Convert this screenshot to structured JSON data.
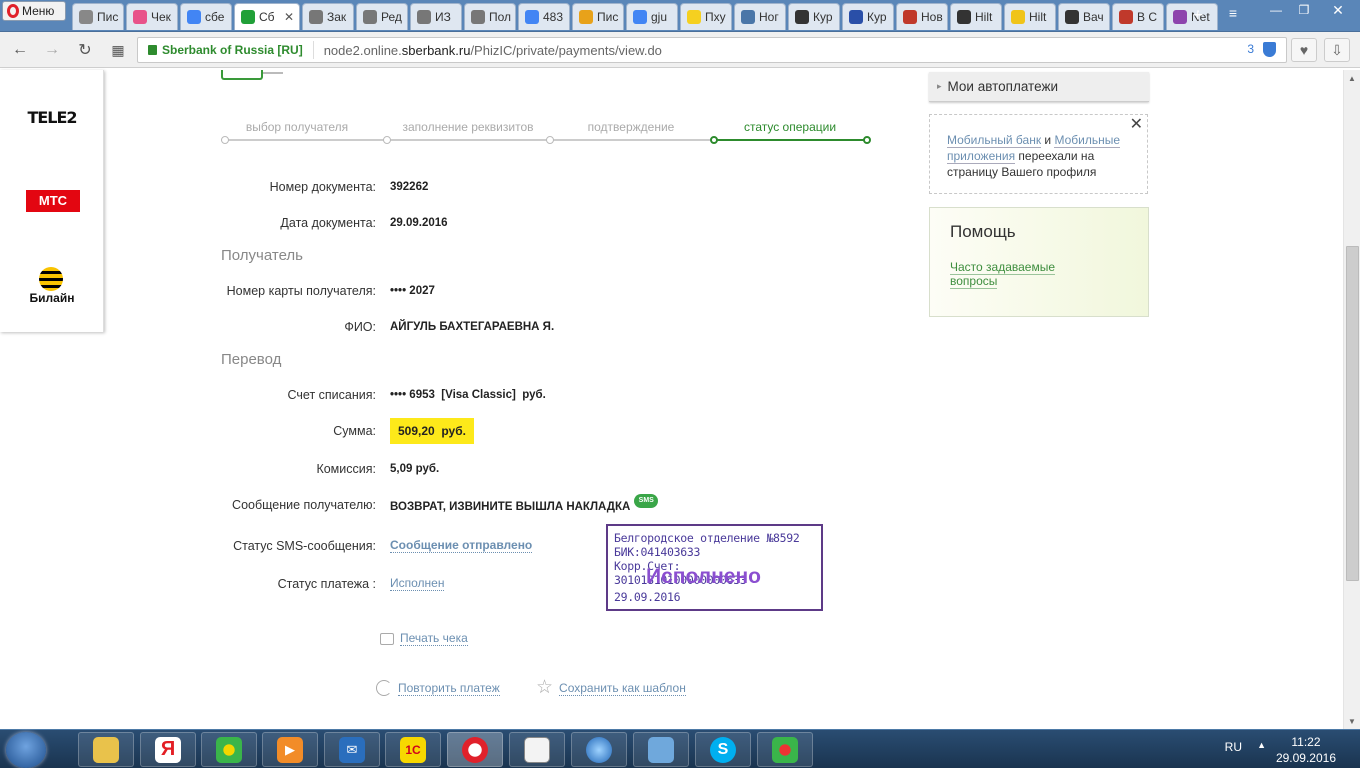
{
  "browser": {
    "menu_label": "Меню",
    "tabs": [
      {
        "label": "Пис",
        "icon": "opera-icon",
        "color": "#888888"
      },
      {
        "label": "Чек",
        "icon": "ue-icon",
        "color": "#e8528a"
      },
      {
        "label": "сбе",
        "icon": "google-icon",
        "color": "#4285f4"
      },
      {
        "label": "Сб",
        "icon": "sberbank-icon",
        "color": "#21a038",
        "active": true
      },
      {
        "label": "Зак",
        "icon": "doc-icon",
        "color": "#777777"
      },
      {
        "label": "Ред",
        "icon": "doc-icon",
        "color": "#777777"
      },
      {
        "label": "ИЗ",
        "icon": "doc-icon",
        "color": "#777777"
      },
      {
        "label": "Пол",
        "icon": "doc-icon",
        "color": "#777777"
      },
      {
        "label": "483",
        "icon": "google-icon",
        "color": "#4285f4"
      },
      {
        "label": "Пис",
        "icon": "mail-icon",
        "color": "#e8a21a"
      },
      {
        "label": "gju",
        "icon": "google-icon",
        "color": "#4285f4"
      },
      {
        "label": "Пху",
        "icon": "smile-icon",
        "color": "#f5d020"
      },
      {
        "label": "Ног",
        "icon": "vk-icon",
        "color": "#4a76a8"
      },
      {
        "label": "Кур",
        "icon": "tn-icon",
        "color": "#333333"
      },
      {
        "label": "Кур",
        "icon": "currency-icon",
        "color": "#2a4fa8"
      },
      {
        "label": "Нов",
        "icon": "news-icon",
        "color": "#c0392b"
      },
      {
        "label": "Hilt",
        "icon": "tripadvisor-icon",
        "color": "#333333"
      },
      {
        "label": "Hilt",
        "icon": "bookmark-icon",
        "color": "#f0c419"
      },
      {
        "label": "Вач",
        "icon": "tripadvisor-icon",
        "color": "#333333"
      },
      {
        "label": "В С",
        "icon": "news-icon",
        "color": "#c0392b"
      },
      {
        "label": "Net",
        "icon": "net-icon",
        "color": "#8e44ad"
      }
    ],
    "site_identity": "Sberbank of Russia [RU]",
    "url_host": "node2.online.",
    "url_domain": "sberbank.ru",
    "url_path": "/PhizIC/private/payments/view.do",
    "badge_count": "3"
  },
  "operators": [
    "TELE2",
    "МТС",
    "Билайн"
  ],
  "steps": [
    "выбор получателя",
    "заполнение реквизитов",
    "подтверждение",
    "статус операции"
  ],
  "details": {
    "doc_number_label": "Номер документа:",
    "doc_number": "392262",
    "doc_date_label": "Дата документа:",
    "doc_date": "29.09.2016",
    "recipient_section": "Получатель",
    "card_label": "Номер карты получателя:",
    "card_value": "•••• 2027",
    "fio_label": "ФИО:",
    "fio_value": "АЙГУЛЬ БАХТЕГАРАЕВНА Я.",
    "transfer_section": "Перевод",
    "account_label": "Счет списания:",
    "account_value": "•••• 6953  [Visa Classic]  руб.",
    "sum_label": "Сумма:",
    "sum_value": "509,20  руб.",
    "fee_label": "Комиссия:",
    "fee_value": "5,09 руб.",
    "message_label": "Сообщение получателю:",
    "message_value": "ВОЗВРАТ, ИЗВИНИТЕ ВЫШЛА НАКЛАДКА",
    "sms_badge": "SMS",
    "sms_status_label": "Статус SMS-сообщения:",
    "sms_status_value": "Сообщение отправлено",
    "pay_status_label": "Статус платежа :",
    "pay_status_value": "Исполнен"
  },
  "stamp": {
    "line1": "Белгородское отделение №8592",
    "line2": "БИК:041403633",
    "line3": "Корр.Счет: 30101810100000000633",
    "big": "Исполнено",
    "date": "29.09.2016"
  },
  "actions": {
    "print": "Печать чека",
    "repeat": "Повторить платеж",
    "save_template": "Сохранить как шаблон"
  },
  "sidebar": {
    "autopay": "Мои автоплатежи",
    "notice_link1": "Мобильный банк",
    "notice_and": " и ",
    "notice_link2": "Мобильные приложения",
    "notice_rest": " переехали на страницу Вашего профиля",
    "help_title": "Помощь",
    "help_link": "Часто задаваемые вопросы"
  },
  "taskbar": {
    "lang": "RU",
    "time": "11:22",
    "date": "29.09.2016"
  }
}
